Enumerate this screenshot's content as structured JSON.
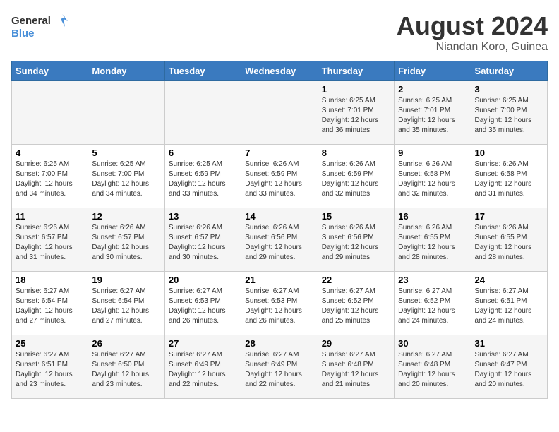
{
  "logo": {
    "line1": "General",
    "line2": "Blue"
  },
  "title": "August 2024",
  "subtitle": "Niandan Koro, Guinea",
  "days_of_week": [
    "Sunday",
    "Monday",
    "Tuesday",
    "Wednesday",
    "Thursday",
    "Friday",
    "Saturday"
  ],
  "weeks": [
    [
      {
        "day": null,
        "info": null
      },
      {
        "day": null,
        "info": null
      },
      {
        "day": null,
        "info": null
      },
      {
        "day": null,
        "info": null
      },
      {
        "day": "1",
        "info": "Sunrise: 6:25 AM\nSunset: 7:01 PM\nDaylight: 12 hours and 36 minutes."
      },
      {
        "day": "2",
        "info": "Sunrise: 6:25 AM\nSunset: 7:01 PM\nDaylight: 12 hours and 35 minutes."
      },
      {
        "day": "3",
        "info": "Sunrise: 6:25 AM\nSunset: 7:00 PM\nDaylight: 12 hours and 35 minutes."
      }
    ],
    [
      {
        "day": "4",
        "info": "Sunrise: 6:25 AM\nSunset: 7:00 PM\nDaylight: 12 hours and 34 minutes."
      },
      {
        "day": "5",
        "info": "Sunrise: 6:25 AM\nSunset: 7:00 PM\nDaylight: 12 hours and 34 minutes."
      },
      {
        "day": "6",
        "info": "Sunrise: 6:25 AM\nSunset: 6:59 PM\nDaylight: 12 hours and 33 minutes."
      },
      {
        "day": "7",
        "info": "Sunrise: 6:26 AM\nSunset: 6:59 PM\nDaylight: 12 hours and 33 minutes."
      },
      {
        "day": "8",
        "info": "Sunrise: 6:26 AM\nSunset: 6:59 PM\nDaylight: 12 hours and 32 minutes."
      },
      {
        "day": "9",
        "info": "Sunrise: 6:26 AM\nSunset: 6:58 PM\nDaylight: 12 hours and 32 minutes."
      },
      {
        "day": "10",
        "info": "Sunrise: 6:26 AM\nSunset: 6:58 PM\nDaylight: 12 hours and 31 minutes."
      }
    ],
    [
      {
        "day": "11",
        "info": "Sunrise: 6:26 AM\nSunset: 6:57 PM\nDaylight: 12 hours and 31 minutes."
      },
      {
        "day": "12",
        "info": "Sunrise: 6:26 AM\nSunset: 6:57 PM\nDaylight: 12 hours and 30 minutes."
      },
      {
        "day": "13",
        "info": "Sunrise: 6:26 AM\nSunset: 6:57 PM\nDaylight: 12 hours and 30 minutes."
      },
      {
        "day": "14",
        "info": "Sunrise: 6:26 AM\nSunset: 6:56 PM\nDaylight: 12 hours and 29 minutes."
      },
      {
        "day": "15",
        "info": "Sunrise: 6:26 AM\nSunset: 6:56 PM\nDaylight: 12 hours and 29 minutes."
      },
      {
        "day": "16",
        "info": "Sunrise: 6:26 AM\nSunset: 6:55 PM\nDaylight: 12 hours and 28 minutes."
      },
      {
        "day": "17",
        "info": "Sunrise: 6:26 AM\nSunset: 6:55 PM\nDaylight: 12 hours and 28 minutes."
      }
    ],
    [
      {
        "day": "18",
        "info": "Sunrise: 6:27 AM\nSunset: 6:54 PM\nDaylight: 12 hours and 27 minutes."
      },
      {
        "day": "19",
        "info": "Sunrise: 6:27 AM\nSunset: 6:54 PM\nDaylight: 12 hours and 27 minutes."
      },
      {
        "day": "20",
        "info": "Sunrise: 6:27 AM\nSunset: 6:53 PM\nDaylight: 12 hours and 26 minutes."
      },
      {
        "day": "21",
        "info": "Sunrise: 6:27 AM\nSunset: 6:53 PM\nDaylight: 12 hours and 26 minutes."
      },
      {
        "day": "22",
        "info": "Sunrise: 6:27 AM\nSunset: 6:52 PM\nDaylight: 12 hours and 25 minutes."
      },
      {
        "day": "23",
        "info": "Sunrise: 6:27 AM\nSunset: 6:52 PM\nDaylight: 12 hours and 24 minutes."
      },
      {
        "day": "24",
        "info": "Sunrise: 6:27 AM\nSunset: 6:51 PM\nDaylight: 12 hours and 24 minutes."
      }
    ],
    [
      {
        "day": "25",
        "info": "Sunrise: 6:27 AM\nSunset: 6:51 PM\nDaylight: 12 hours and 23 minutes."
      },
      {
        "day": "26",
        "info": "Sunrise: 6:27 AM\nSunset: 6:50 PM\nDaylight: 12 hours and 23 minutes."
      },
      {
        "day": "27",
        "info": "Sunrise: 6:27 AM\nSunset: 6:49 PM\nDaylight: 12 hours and 22 minutes."
      },
      {
        "day": "28",
        "info": "Sunrise: 6:27 AM\nSunset: 6:49 PM\nDaylight: 12 hours and 22 minutes."
      },
      {
        "day": "29",
        "info": "Sunrise: 6:27 AM\nSunset: 6:48 PM\nDaylight: 12 hours and 21 minutes."
      },
      {
        "day": "30",
        "info": "Sunrise: 6:27 AM\nSunset: 6:48 PM\nDaylight: 12 hours and 20 minutes."
      },
      {
        "day": "31",
        "info": "Sunrise: 6:27 AM\nSunset: 6:47 PM\nDaylight: 12 hours and 20 minutes."
      }
    ]
  ]
}
